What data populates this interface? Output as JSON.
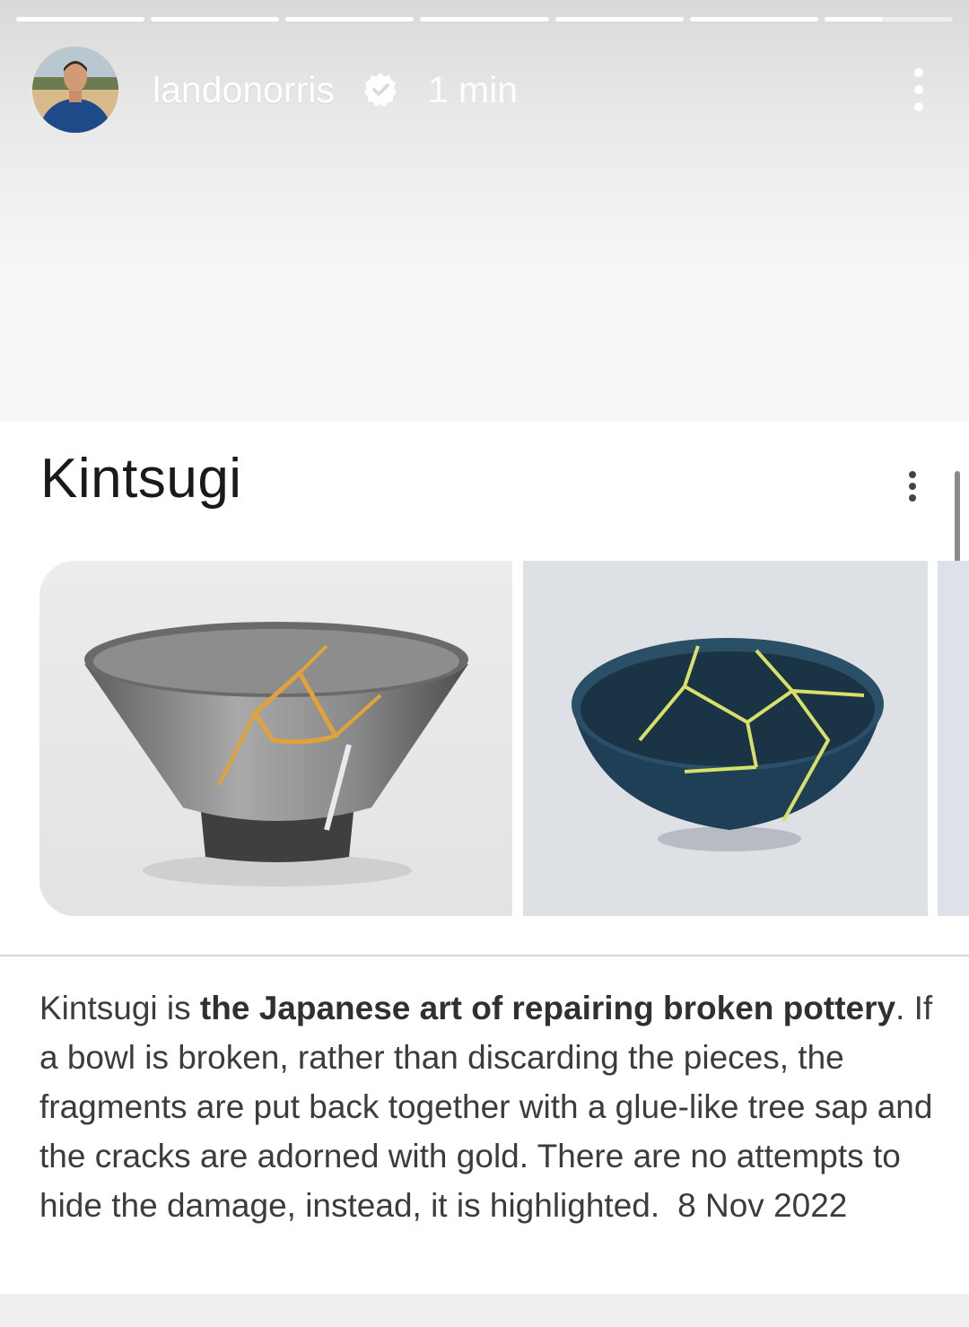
{
  "story": {
    "progress_segments": [
      1,
      1,
      1,
      1,
      1,
      1,
      0.45
    ],
    "username": "landonorris",
    "time": "1 min",
    "verified": true,
    "icons": {
      "verified": "verified-badge-icon",
      "more": "more-vertical-icon"
    }
  },
  "card": {
    "title": "Kintsugi",
    "images": [
      {
        "name": "gray bowl with gold cracks"
      },
      {
        "name": "blue bowl with gold cracks"
      }
    ],
    "description": {
      "part1": "Kintsugi is ",
      "bold1": "the Japanese art of repairing broken",
      "bold2": "pottery",
      "part2": ". If a bowl is broken, rather than discarding the pieces, the fragments are put back together with a glue-like tree sap and the cracks are adorned with gold. There are no attempts to hide the damage, instead, it is highlighted.",
      "date": "8 Nov 2022"
    }
  },
  "colors": {
    "gold": "#e2a23a",
    "bowl_blue": "#1f3f55"
  }
}
